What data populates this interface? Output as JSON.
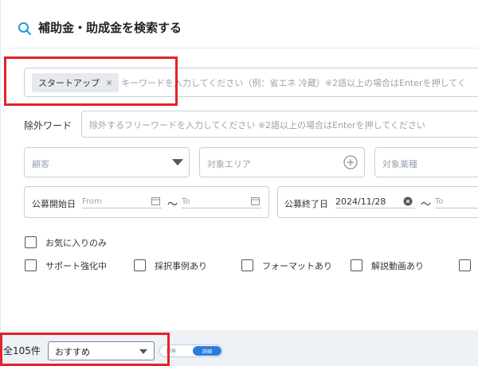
{
  "header": {
    "title": "補助金・助成金を検索する"
  },
  "keyword": {
    "chip_label": "スタートアップ",
    "chip_remove": "×",
    "placeholder": "キーワードを入力してください（例：省エネ 冷蔵）※2語以上の場合はEnterを押してく"
  },
  "exclude": {
    "label": "除外ワード",
    "placeholder": "除外するフリーワードを入力してください ※2語以上の場合はEnterを押してください"
  },
  "filters": {
    "customer_placeholder": "顧客",
    "area_placeholder": "対象エリア",
    "industry_placeholder": "対象業種"
  },
  "dates": {
    "start_label": "公募開始日",
    "end_label": "公募終了日",
    "from_placeholder": "From",
    "to_placeholder": "To",
    "tilde": "〜",
    "end_from_value": "2024/11/28"
  },
  "checkboxes": {
    "favorites": "お気に入りのみ",
    "support": "サポート強化中",
    "cases": "採択事例あり",
    "format": "フォーマットあり",
    "video": "解説動画あり"
  },
  "results": {
    "count": "全105件",
    "sort_value": "おすすめ",
    "view_simple": "簡易",
    "view_detail": "詳細"
  },
  "colors": {
    "accent": "#2c7ddb",
    "highlight": "#e0242b",
    "search_icon": "#1e9bd6"
  }
}
